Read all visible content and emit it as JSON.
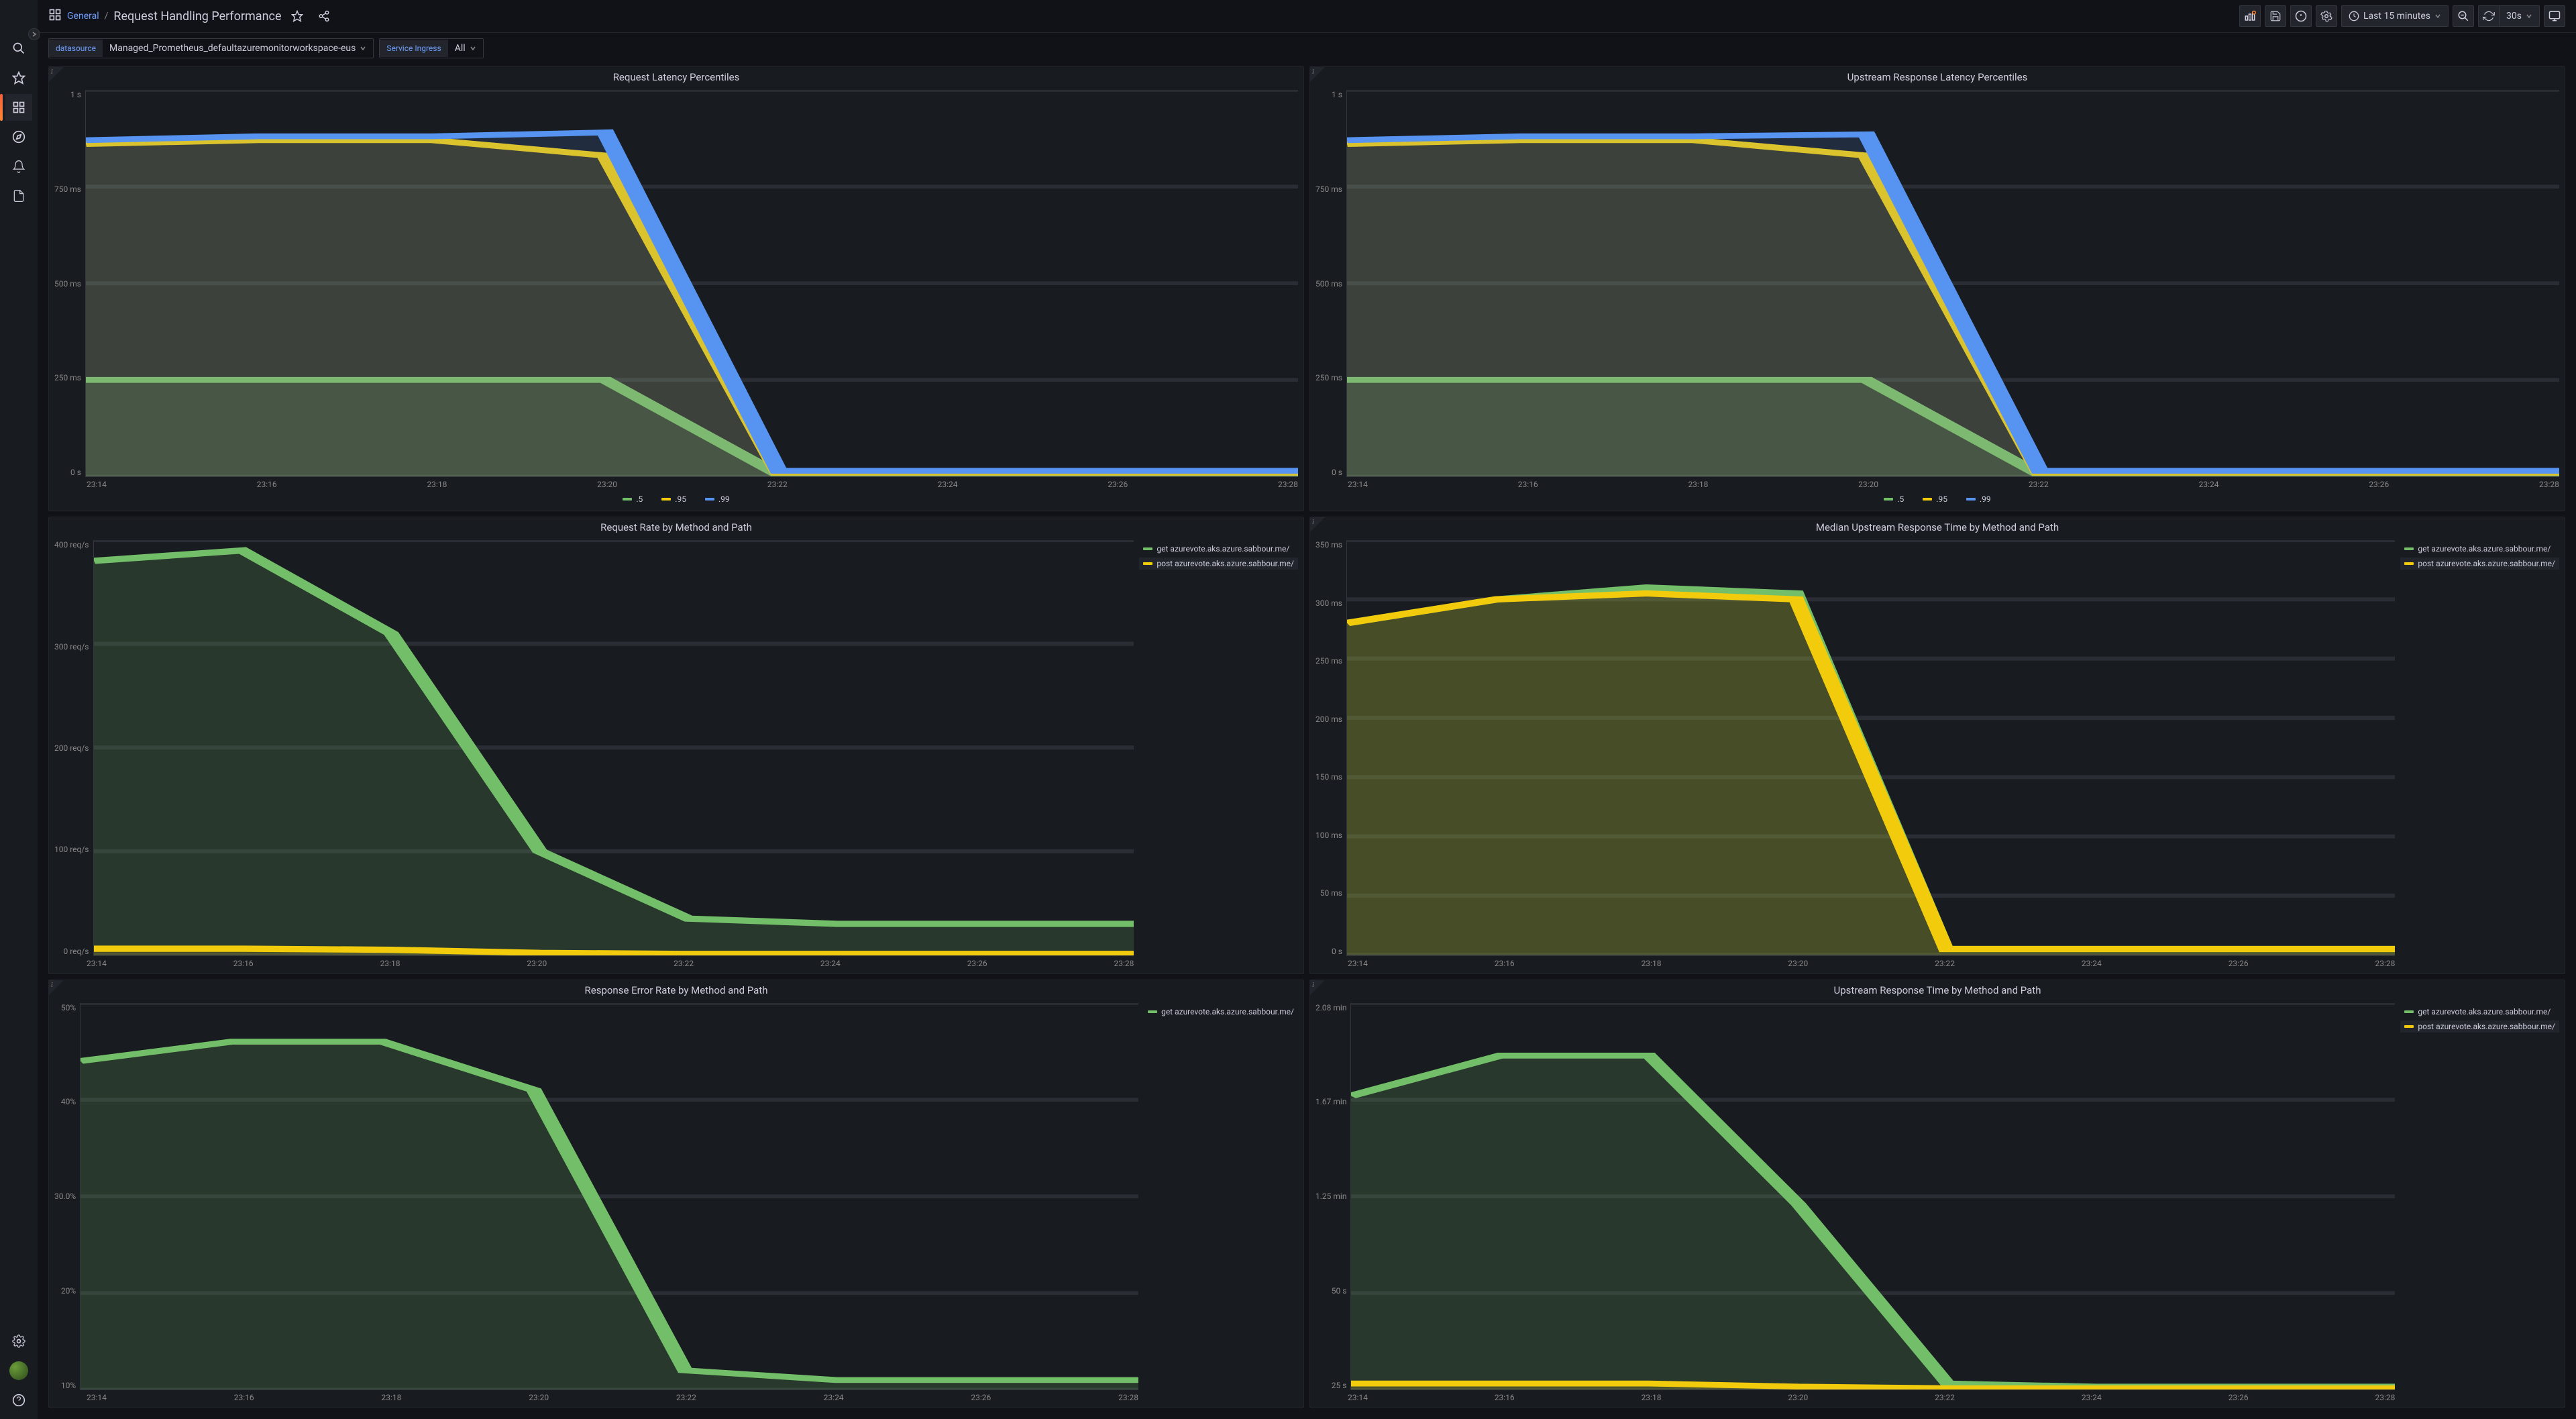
{
  "breadcrumb": {
    "folder": "General",
    "title": "Request Handling Performance"
  },
  "toolbar": {
    "time_range": "Last 15 minutes",
    "refresh_interval": "30s"
  },
  "vars": {
    "datasource": {
      "label": "datasource",
      "value": "Managed_Prometheus_defaultazuremonitorworkspace-eus"
    },
    "ingress": {
      "label": "Service Ingress",
      "value": "All"
    }
  },
  "series_labels": {
    "p50": ".5",
    "p95": ".95",
    "p99": ".99",
    "get": "get azurevote.aks.azure.sabbour.me/",
    "post": "post azurevote.aks.azure.sabbour.me/"
  },
  "colors": {
    "green": "#73bf69",
    "yellow": "#f2cc0c",
    "blue": "#5794f2"
  },
  "x_ticks": [
    "23:14",
    "23:16",
    "23:18",
    "23:20",
    "23:22",
    "23:24",
    "23:26",
    "23:28"
  ],
  "panels": [
    {
      "id": "req_lat",
      "title": "Request Latency Percentiles",
      "legend": "horizontal",
      "legend_items": [
        "p50",
        "p95",
        "p99"
      ],
      "has_info": true
    },
    {
      "id": "upstream_lat",
      "title": "Upstream Response Latency Percentiles",
      "legend": "horizontal",
      "legend_items": [
        "p50",
        "p95",
        "p99"
      ],
      "has_info": true
    },
    {
      "id": "req_rate",
      "title": "Request Rate by Method and Path",
      "legend": "vertical",
      "legend_items": [
        "get",
        "post"
      ],
      "has_info": false,
      "highlight": 1
    },
    {
      "id": "median_upstream",
      "title": "Median Upstream Response Time by Method and Path",
      "legend": "vertical",
      "legend_items": [
        "get",
        "post"
      ],
      "has_info": true,
      "highlight": 1
    },
    {
      "id": "err_rate",
      "title": "Response Error Rate by Method and Path",
      "legend": "vertical",
      "legend_items": [
        "get"
      ],
      "has_info": true
    },
    {
      "id": "upstream_time",
      "title": "Upstream Response Time by Method and Path",
      "legend": "vertical",
      "legend_items": [
        "get",
        "post"
      ],
      "has_info": true,
      "highlight": 1
    }
  ],
  "chart_data": [
    {
      "id": "req_lat",
      "type": "area",
      "x": [
        "23:14",
        "23:16",
        "23:18",
        "23:20",
        "23:22",
        "23:24",
        "23:26",
        "23:28"
      ],
      "y_ticks": [
        "1 s",
        "750 ms",
        "500 ms",
        "250 ms",
        "0 s"
      ],
      "ylim": [
        0,
        1000
      ],
      "series": [
        {
          "name": ".5",
          "color": "green",
          "values": [
            250,
            250,
            250,
            250,
            5,
            5,
            5,
            5
          ]
        },
        {
          "name": ".95",
          "color": "yellow",
          "values": [
            860,
            870,
            870,
            830,
            10,
            10,
            10,
            10
          ]
        },
        {
          "name": ".99",
          "color": "blue",
          "values": [
            870,
            880,
            880,
            890,
            15,
            15,
            15,
            15
          ]
        }
      ]
    },
    {
      "id": "upstream_lat",
      "type": "area",
      "x": [
        "23:14",
        "23:16",
        "23:18",
        "23:20",
        "23:22",
        "23:24",
        "23:26",
        "23:28"
      ],
      "y_ticks": [
        "1 s",
        "750 ms",
        "500 ms",
        "250 ms",
        "0 s"
      ],
      "ylim": [
        0,
        1000
      ],
      "series": [
        {
          "name": ".5",
          "color": "green",
          "values": [
            250,
            250,
            250,
            250,
            5,
            5,
            5,
            5
          ]
        },
        {
          "name": ".95",
          "color": "yellow",
          "values": [
            860,
            870,
            870,
            830,
            10,
            10,
            10,
            10
          ]
        },
        {
          "name": ".99",
          "color": "blue",
          "values": [
            870,
            880,
            880,
            885,
            15,
            15,
            15,
            15
          ]
        }
      ]
    },
    {
      "id": "req_rate",
      "type": "area",
      "x": [
        "23:14",
        "23:16",
        "23:18",
        "23:20",
        "23:22",
        "23:24",
        "23:26",
        "23:28"
      ],
      "y_ticks": [
        "400 req/s",
        "300 req/s",
        "200 req/s",
        "100 req/s",
        "0 req/s"
      ],
      "ylim": [
        0,
        400
      ],
      "series": [
        {
          "name": "get azurevote.aks.azure.sabbour.me/",
          "color": "green",
          "values": [
            380,
            390,
            310,
            100,
            35,
            30,
            30,
            30
          ]
        },
        {
          "name": "post azurevote.aks.azure.sabbour.me/",
          "color": "yellow",
          "values": [
            6,
            6,
            5,
            2,
            1,
            1,
            1,
            1
          ]
        }
      ]
    },
    {
      "id": "median_upstream",
      "type": "area",
      "x": [
        "23:14",
        "23:16",
        "23:18",
        "23:20",
        "23:22",
        "23:24",
        "23:26",
        "23:28"
      ],
      "y_ticks": [
        "350 ms",
        "300 ms",
        "250 ms",
        "200 ms",
        "150 ms",
        "100 ms",
        "50 ms",
        "0 s"
      ],
      "ylim": [
        0,
        350
      ],
      "series": [
        {
          "name": "get azurevote.aks.azure.sabbour.me/",
          "color": "green",
          "values": [
            280,
            300,
            310,
            305,
            5,
            5,
            5,
            5
          ]
        },
        {
          "name": "post azurevote.aks.azure.sabbour.me/",
          "color": "yellow",
          "values": [
            280,
            300,
            305,
            300,
            5,
            5,
            5,
            5
          ]
        }
      ]
    },
    {
      "id": "err_rate",
      "type": "area",
      "x": [
        "23:14",
        "23:16",
        "23:18",
        "23:20",
        "23:22",
        "23:24",
        "23:26",
        "23:28"
      ],
      "y_ticks": [
        "50%",
        "40%",
        "30.0%",
        "20%",
        "10%"
      ],
      "ylim": [
        10,
        50
      ],
      "series": [
        {
          "name": "get azurevote.aks.azure.sabbour.me/",
          "color": "green",
          "values": [
            44,
            46,
            46,
            41,
            12,
            11,
            11,
            11
          ]
        }
      ]
    },
    {
      "id": "upstream_time",
      "type": "area",
      "x": [
        "23:14",
        "23:16",
        "23:18",
        "23:20",
        "23:22",
        "23:24",
        "23:26",
        "23:28"
      ],
      "y_ticks": [
        "2.08 min",
        "1.67 min",
        "1.25 min",
        "50 s",
        "25 s"
      ],
      "ylim": [
        0,
        125
      ],
      "series": [
        {
          "name": "get azurevote.aks.azure.sabbour.me/",
          "color": "green",
          "values": [
            95,
            108,
            108,
            60,
            2,
            1,
            1,
            1
          ]
        },
        {
          "name": "post azurevote.aks.azure.sabbour.me/",
          "color": "yellow",
          "values": [
            2,
            2,
            2,
            1,
            0.5,
            0.5,
            0.5,
            0.5
          ]
        }
      ]
    }
  ]
}
